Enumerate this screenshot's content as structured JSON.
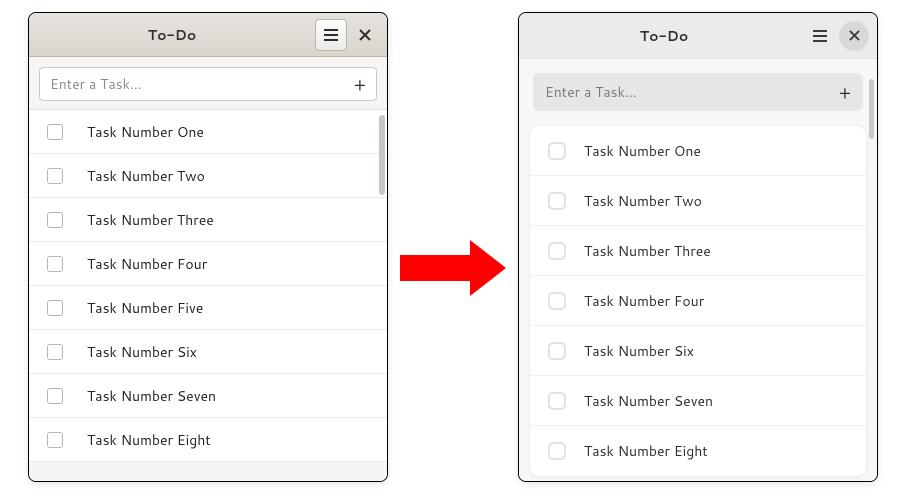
{
  "left": {
    "title": "To-Do",
    "entry_placeholder": "Enter a Task…",
    "tasks": [
      "Task Number One",
      "Task Number Two",
      "Task Number Three",
      "Task Number Four",
      "Task Number Five",
      "Task Number Six",
      "Task Number Seven",
      "Task Number Eight"
    ]
  },
  "right": {
    "title": "To-Do",
    "entry_placeholder": "Enter a Task…",
    "tasks": [
      "Task Number One",
      "Task Number Two",
      "Task Number Three",
      "Task Number Four",
      "Task Number Six",
      "Task Number Seven",
      "Task Number Eight"
    ]
  }
}
